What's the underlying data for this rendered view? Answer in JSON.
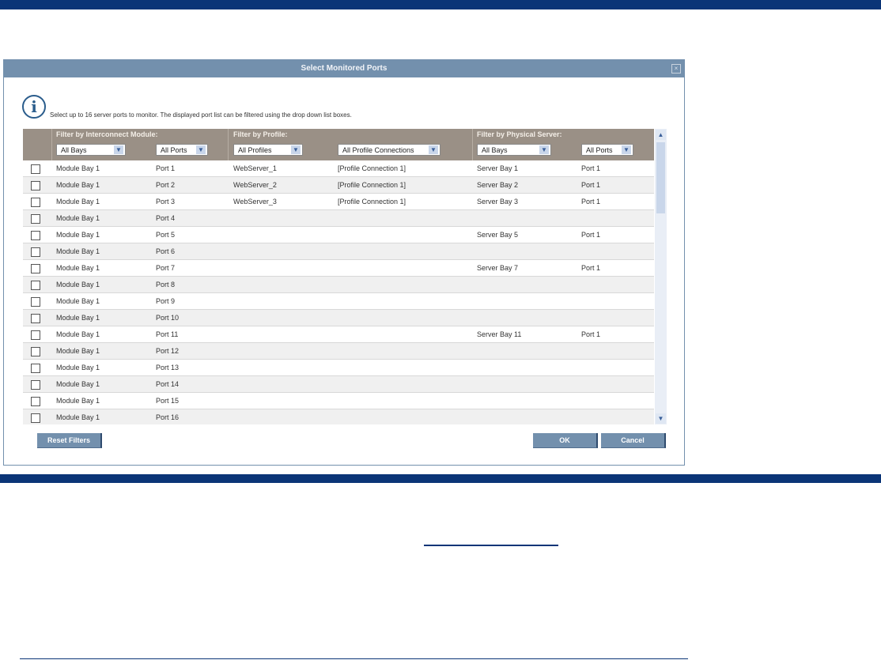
{
  "dialog": {
    "title": "Select Monitored Ports",
    "message": "Select up to 16 server ports to monitor. The displayed port list can be filtered using the drop down list boxes."
  },
  "filters": {
    "module_label": "Filter by Interconnect Module:",
    "profile_label": "Filter by Profile:",
    "server_label": "Filter by Physical Server:",
    "module_bay": "All Bays",
    "module_port": "All Ports",
    "profile": "All Profiles",
    "profile_conn": "All Profile Connections",
    "server_bay": "All Bays",
    "server_port": "All Ports"
  },
  "rows": [
    [
      "Module Bay 1",
      "Port 1",
      "WebServer_1",
      "[Profile Connection 1]",
      "Server Bay 1",
      "Port 1"
    ],
    [
      "Module Bay 1",
      "Port 2",
      "WebServer_2",
      "[Profile Connection 1]",
      "Server Bay 2",
      "Port 1"
    ],
    [
      "Module Bay 1",
      "Port 3",
      "WebServer_3",
      "[Profile Connection 1]",
      "Server Bay 3",
      "Port 1"
    ],
    [
      "Module Bay 1",
      "Port 4",
      "",
      "",
      "",
      ""
    ],
    [
      "Module Bay 1",
      "Port 5",
      "",
      "",
      "Server Bay 5",
      "Port 1"
    ],
    [
      "Module Bay 1",
      "Port 6",
      "",
      "",
      "",
      ""
    ],
    [
      "Module Bay 1",
      "Port 7",
      "",
      "",
      "Server Bay 7",
      "Port 1"
    ],
    [
      "Module Bay 1",
      "Port 8",
      "",
      "",
      "",
      ""
    ],
    [
      "Module Bay 1",
      "Port 9",
      "",
      "",
      "",
      ""
    ],
    [
      "Module Bay 1",
      "Port 10",
      "",
      "",
      "",
      ""
    ],
    [
      "Module Bay 1",
      "Port 11",
      "",
      "",
      "Server Bay 11",
      "Port 1"
    ],
    [
      "Module Bay 1",
      "Port 12",
      "",
      "",
      "",
      ""
    ],
    [
      "Module Bay 1",
      "Port 13",
      "",
      "",
      "",
      ""
    ],
    [
      "Module Bay 1",
      "Port 14",
      "",
      "",
      "",
      ""
    ],
    [
      "Module Bay 1",
      "Port 15",
      "",
      "",
      "",
      ""
    ],
    [
      "Module Bay 1",
      "Port 16",
      "",
      "",
      "",
      ""
    ]
  ],
  "buttons": {
    "reset": "Reset Filters",
    "ok": "OK",
    "cancel": "Cancel"
  },
  "colors": {
    "brand_bar": "#0b3577",
    "titlebar": "#7390ad",
    "header": "#9a9086"
  }
}
